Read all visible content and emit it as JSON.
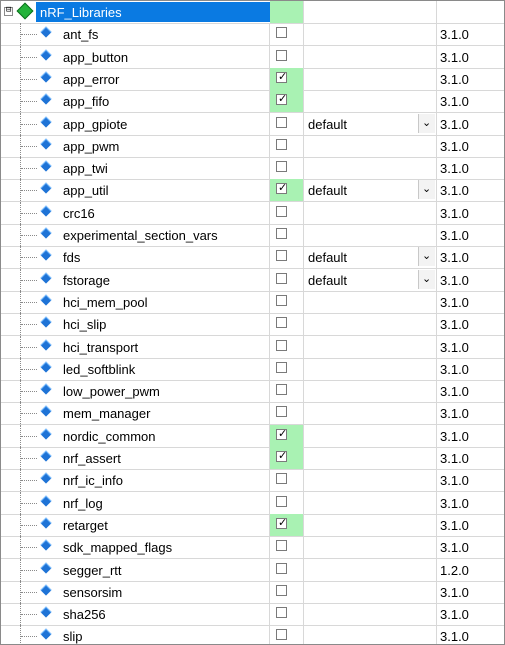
{
  "root": {
    "label": "nRF_Libraries",
    "expander_glyph": "⊟",
    "icon": "component-group-icon",
    "selected": true
  },
  "checkmark_glyph": "✓",
  "dropdown_glyph": "⌄",
  "items": [
    {
      "name": "ant_fs",
      "checked": false,
      "variant": "",
      "version": "3.1.0"
    },
    {
      "name": "app_button",
      "checked": false,
      "variant": "",
      "version": "3.1.0"
    },
    {
      "name": "app_error",
      "checked": true,
      "variant": "",
      "version": "3.1.0"
    },
    {
      "name": "app_fifo",
      "checked": true,
      "variant": "",
      "version": "3.1.0"
    },
    {
      "name": "app_gpiote",
      "checked": false,
      "variant": "default",
      "version": "3.1.0"
    },
    {
      "name": "app_pwm",
      "checked": false,
      "variant": "",
      "version": "3.1.0"
    },
    {
      "name": "app_twi",
      "checked": false,
      "variant": "",
      "version": "3.1.0"
    },
    {
      "name": "app_util",
      "checked": true,
      "variant": "default",
      "version": "3.1.0"
    },
    {
      "name": "crc16",
      "checked": false,
      "variant": "",
      "version": "3.1.0"
    },
    {
      "name": "experimental_section_vars",
      "checked": false,
      "variant": "",
      "version": "3.1.0"
    },
    {
      "name": "fds",
      "checked": false,
      "variant": "default",
      "version": "3.1.0"
    },
    {
      "name": "fstorage",
      "checked": false,
      "variant": "default",
      "version": "3.1.0"
    },
    {
      "name": "hci_mem_pool",
      "checked": false,
      "variant": "",
      "version": "3.1.0"
    },
    {
      "name": "hci_slip",
      "checked": false,
      "variant": "",
      "version": "3.1.0"
    },
    {
      "name": "hci_transport",
      "checked": false,
      "variant": "",
      "version": "3.1.0"
    },
    {
      "name": "led_softblink",
      "checked": false,
      "variant": "",
      "version": "3.1.0"
    },
    {
      "name": "low_power_pwm",
      "checked": false,
      "variant": "",
      "version": "3.1.0"
    },
    {
      "name": "mem_manager",
      "checked": false,
      "variant": "",
      "version": "3.1.0"
    },
    {
      "name": "nordic_common",
      "checked": true,
      "variant": "",
      "version": "3.1.0"
    },
    {
      "name": "nrf_assert",
      "checked": true,
      "variant": "",
      "version": "3.1.0"
    },
    {
      "name": "nrf_ic_info",
      "checked": false,
      "variant": "",
      "version": "3.1.0"
    },
    {
      "name": "nrf_log",
      "checked": false,
      "variant": "",
      "version": "3.1.0"
    },
    {
      "name": "retarget",
      "checked": true,
      "variant": "",
      "version": "3.1.0"
    },
    {
      "name": "sdk_mapped_flags",
      "checked": false,
      "variant": "",
      "version": "3.1.0"
    },
    {
      "name": "segger_rtt",
      "checked": false,
      "variant": "",
      "version": "1.2.0"
    },
    {
      "name": "sensorsim",
      "checked": false,
      "variant": "",
      "version": "3.1.0"
    },
    {
      "name": "sha256",
      "checked": false,
      "variant": "",
      "version": "3.1.0"
    },
    {
      "name": "slip",
      "checked": false,
      "variant": "",
      "version": "3.1.0"
    }
  ],
  "colors": {
    "selection_blue": "#0a7ae2",
    "selected_green": "#a9f2b3",
    "component_blue": "#1e73d6"
  }
}
